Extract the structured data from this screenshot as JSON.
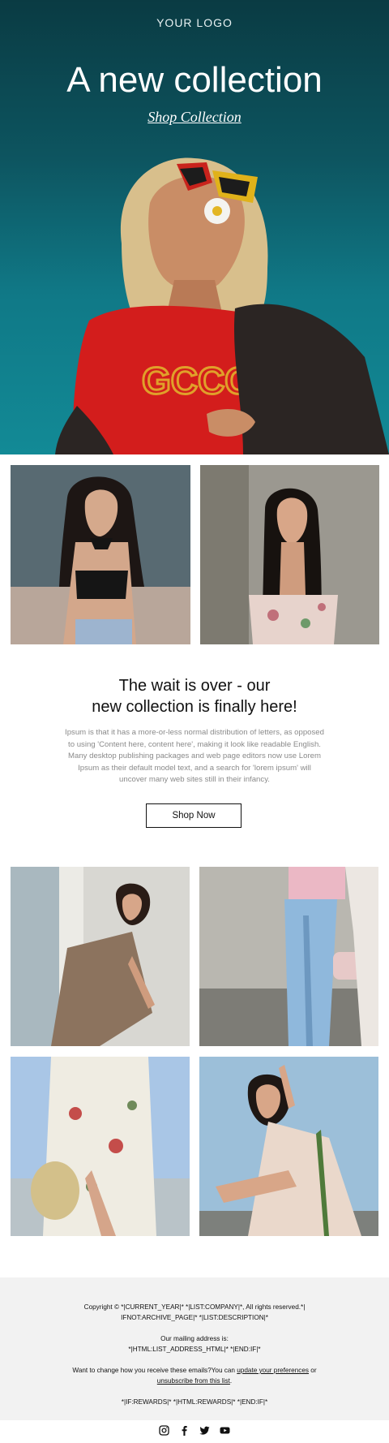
{
  "header": {
    "logo": "YOUR LOGO",
    "title": "A new collection",
    "link": "Shop Collection"
  },
  "intro": {
    "title_line1": "The wait is over - our",
    "title_line2": "new collection is finally here!",
    "body": "Ipsum is that it has a more-or-less normal distribution of letters, as opposed to using 'Content here, content here', making it look like readable English. Many desktop publishing packages and web page editors now use Lorem Ipsum as their default model text, and a search for 'lorem ipsum' will uncover many web sites still in their infancy.",
    "button": "Shop Now"
  },
  "footer": {
    "copyright_line1": "Copyright © *|CURRENT_YEAR|* *|LIST:COMPANY|*, All rights reserved.*|",
    "copyright_line2": "IFNOT:ARCHIVE_PAGE|* *|LIST:DESCRIPTION|*",
    "mailing_label": "Our mailing address is:",
    "mailing_value": "*|HTML:LIST_ADDRESS_HTML|* *|END:IF|*",
    "change_text": "Want to change how you receive these emails?You can ",
    "update_link": "update your preferences",
    "or_text": " or",
    "unsubscribe_link": "unsubscribe from this list",
    "period": ".",
    "rewards": "*|IF:REWARDS|* *|HTML:REWARDS|* *|END:IF|*"
  },
  "social": [
    "instagram-icon",
    "facebook-icon",
    "twitter-icon",
    "youtube-icon"
  ],
  "colors": {
    "hero_top": "#0a3b43",
    "hero_bottom": "#128a96",
    "footer_bg": "#f2f2f2",
    "body_text": "#8a8a8a"
  }
}
